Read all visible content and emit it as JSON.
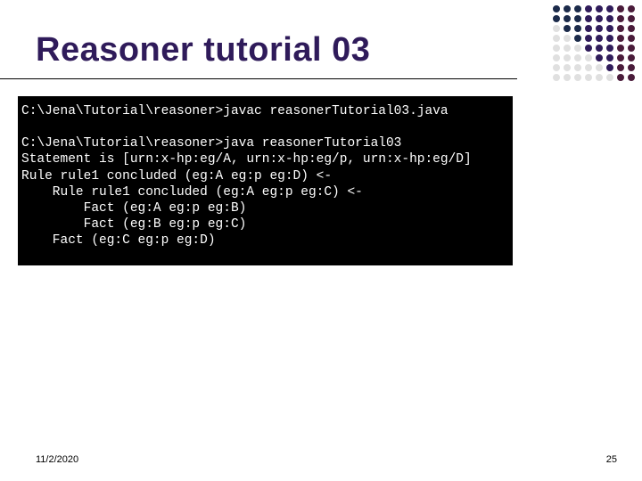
{
  "slide": {
    "title": "Reasoner tutorial 03",
    "footer_date": "11/2/2020",
    "page_number": "25"
  },
  "dots": {
    "colors": [
      [
        "#1b2a4a",
        "#1b2a4a",
        "#1b2a4a",
        "#2f1b5a",
        "#2f1b5a",
        "#2f1b5a",
        "#4a1b3a",
        "#4a1b3a"
      ],
      [
        "#1b2a4a",
        "#1b2a4a",
        "#1b2a4a",
        "#2f1b5a",
        "#2f1b5a",
        "#2f1b5a",
        "#4a1b3a",
        "#4a1b3a"
      ],
      [
        "#e0e0e0",
        "#1b2a4a",
        "#1b2a4a",
        "#2f1b5a",
        "#2f1b5a",
        "#2f1b5a",
        "#4a1b3a",
        "#4a1b3a"
      ],
      [
        "#e0e0e0",
        "#e0e0e0",
        "#1b2a4a",
        "#2f1b5a",
        "#2f1b5a",
        "#2f1b5a",
        "#4a1b3a",
        "#4a1b3a"
      ],
      [
        "#e0e0e0",
        "#e0e0e0",
        "#e0e0e0",
        "#2f1b5a",
        "#2f1b5a",
        "#2f1b5a",
        "#4a1b3a",
        "#4a1b3a"
      ],
      [
        "#e0e0e0",
        "#e0e0e0",
        "#e0e0e0",
        "#e0e0e0",
        "#2f1b5a",
        "#2f1b5a",
        "#4a1b3a",
        "#4a1b3a"
      ],
      [
        "#e0e0e0",
        "#e0e0e0",
        "#e0e0e0",
        "#e0e0e0",
        "#e0e0e0",
        "#2f1b5a",
        "#4a1b3a",
        "#4a1b3a"
      ],
      [
        "#e0e0e0",
        "#e0e0e0",
        "#e0e0e0",
        "#e0e0e0",
        "#e0e0e0",
        "#e0e0e0",
        "#4a1b3a",
        "#4a1b3a"
      ]
    ]
  },
  "terminal": {
    "lines": [
      "C:\\Jena\\Tutorial\\reasoner>javac reasonerTutorial03.java",
      "",
      "C:\\Jena\\Tutorial\\reasoner>java reasonerTutorial03",
      "Statement is [urn:x-hp:eg/A, urn:x-hp:eg/p, urn:x-hp:eg/D]",
      "Rule rule1 concluded (eg:A eg:p eg:D) <-",
      "    Rule rule1 concluded (eg:A eg:p eg:C) <-",
      "        Fact (eg:A eg:p eg:B)",
      "        Fact (eg:B eg:p eg:C)",
      "    Fact (eg:C eg:p eg:D)"
    ]
  }
}
